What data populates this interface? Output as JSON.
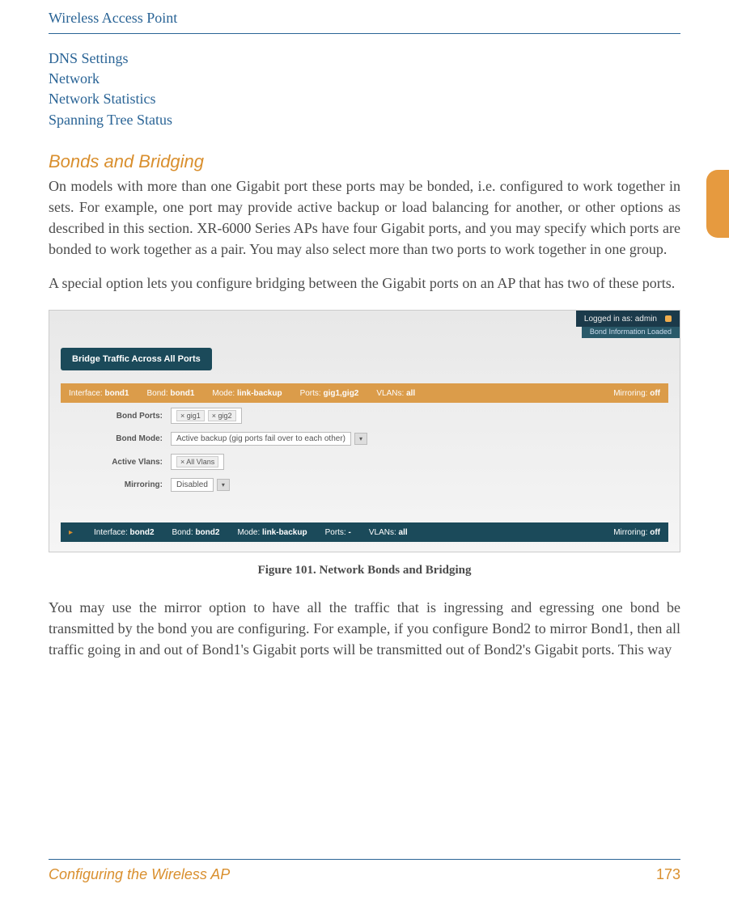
{
  "header": {
    "title": "Wireless Access Point"
  },
  "toc": {
    "items": [
      "DNS Settings",
      "Network",
      "Network Statistics",
      "Spanning Tree Status"
    ]
  },
  "section": {
    "heading": "Bonds and Bridging"
  },
  "paragraphs": {
    "p1": "On models with more than one Gigabit port these ports may be bonded, i.e. configured to work together in sets. For example, one port may provide active backup or load balancing for another, or other options as described in this section. XR-6000 Series APs have four Gigabit ports, and you may specify which ports are bonded to work together as a pair. You may also select more than two ports to work together in one group.",
    "p2": "A special option lets you configure bridging between the Gigabit ports on an AP that has two of these ports.",
    "p3": "You may use the mirror option to have all the traffic that is ingressing and egressing one bond be transmitted by the bond you are configuring. For example, if you configure Bond2 to mirror Bond1, then all traffic going in and out of Bond1's Gigabit ports will be transmitted out of Bond2's Gigabit ports. This way"
  },
  "figure": {
    "caption": "Figure 101. Network Bonds and Bridging",
    "topbar": {
      "logged_in": "Logged in as: admin"
    },
    "subtop": "Bond Information Loaded",
    "bridge_button": "Bridge Traffic Across All Ports",
    "bond1": {
      "interface_label": "Interface:",
      "interface_value": "bond1",
      "bond_label": "Bond:",
      "bond_value": "bond1",
      "mode_label": "Mode:",
      "mode_value": "link-backup",
      "ports_label": "Ports:",
      "ports_value": "gig1,gig2",
      "vlans_label": "VLANs:",
      "vlans_value": "all",
      "mirror_label": "Mirroring:",
      "mirror_value": "off"
    },
    "form": {
      "bond_ports_label": "Bond Ports:",
      "bond_ports_chip1": "× gig1",
      "bond_ports_chip2": "× gig2",
      "bond_mode_label": "Bond Mode:",
      "bond_mode_value": "Active backup (gig ports fail over to each other)",
      "active_vlans_label": "Active Vlans:",
      "active_vlans_chip": "× All Vlans",
      "mirroring_label": "Mirroring:",
      "mirroring_value": "Disabled"
    },
    "bond2": {
      "interface_label": "Interface:",
      "interface_value": "bond2",
      "bond_label": "Bond:",
      "bond_value": "bond2",
      "mode_label": "Mode:",
      "mode_value": "link-backup",
      "ports_label": "Ports:",
      "ports_value": "-",
      "vlans_label": "VLANs:",
      "vlans_value": "all",
      "mirror_label": "Mirroring:",
      "mirror_value": "off"
    }
  },
  "footer": {
    "left": "Configuring the Wireless AP",
    "page": "173"
  }
}
